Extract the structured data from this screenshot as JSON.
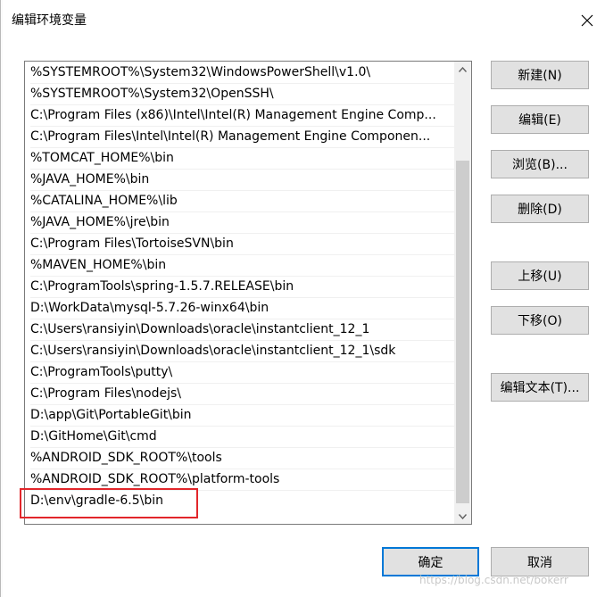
{
  "dialog": {
    "title": "编辑环境变量"
  },
  "path_list": [
    "%SYSTEMROOT%\\System32\\WindowsPowerShell\\v1.0\\",
    "%SYSTEMROOT%\\System32\\OpenSSH\\",
    "C:\\Program Files (x86)\\Intel\\Intel(R) Management Engine Comp...",
    "C:\\Program Files\\Intel\\Intel(R) Management Engine Componen...",
    "%TOMCAT_HOME%\\bin",
    "%JAVA_HOME%\\bin",
    "%CATALINA_HOME%\\lib",
    "%JAVA_HOME%\\jre\\bin",
    "C:\\Program Files\\TortoiseSVN\\bin",
    "%MAVEN_HOME%\\bin",
    "C:\\ProgramTools\\spring-1.5.7.RELEASE\\bin",
    "D:\\WorkData\\mysql-5.7.26-winx64\\bin",
    "C:\\Users\\ransiyin\\Downloads\\oracle\\instantclient_12_1",
    "C:\\Users\\ransiyin\\Downloads\\oracle\\instantclient_12_1\\sdk",
    "C:\\ProgramTools\\putty\\",
    "C:\\Program Files\\nodejs\\",
    "D:\\app\\Git\\PortableGit\\bin",
    "D:\\GitHome\\Git\\cmd",
    "%ANDROID_SDK_ROOT%\\tools",
    "%ANDROID_SDK_ROOT%\\platform-tools",
    "D:\\env\\gradle-6.5\\bin"
  ],
  "buttons": {
    "new": "新建(N)",
    "edit": "编辑(E)",
    "browse": "浏览(B)...",
    "delete": "删除(D)",
    "move_up": "上移(U)",
    "move_down": "下移(O)",
    "edit_text": "编辑文本(T)...",
    "ok": "确定",
    "cancel": "取消"
  },
  "watermark": "https://blog.csdn.net/bokerr",
  "colors": {
    "highlight": "#e2262b",
    "default_button_border": "#0078d7",
    "button_face": "#e1e1e1"
  },
  "icons": {
    "close": "close-icon",
    "scroll_up": "chevron-up-icon",
    "scroll_down": "chevron-down-icon"
  }
}
